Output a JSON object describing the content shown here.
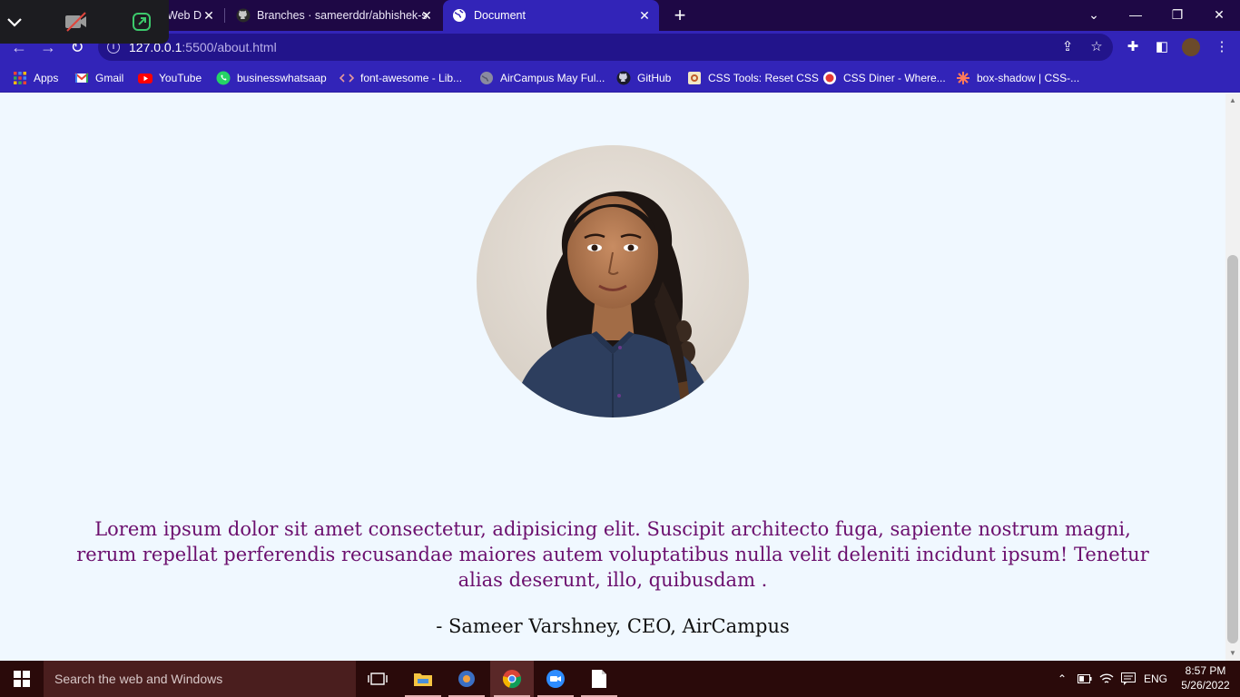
{
  "browser": {
    "tabs": [
      {
        "label": "Web D",
        "favicon": "webdev-icon"
      },
      {
        "label": "Branches · sameerddr/abhishek-s",
        "favicon": "github-icon"
      },
      {
        "label": "Document",
        "favicon": "globe-icon",
        "active": true
      }
    ],
    "url_host": "127.0.0.1",
    "url_path": ":5500/about.html",
    "accent": "#3224b8"
  },
  "bookmarks": [
    {
      "label": "Apps",
      "icon": "apps-grid-icon"
    },
    {
      "label": "Gmail",
      "icon": "gmail-icon"
    },
    {
      "label": "YouTube",
      "icon": "youtube-icon"
    },
    {
      "label": "businesswhatsaap",
      "icon": "whatsapp-icon"
    },
    {
      "label": "font-awesome - Lib...",
      "icon": "code-icon"
    },
    {
      "label": "AirCampus May Ful...",
      "icon": "globe-icon"
    },
    {
      "label": "GitHub",
      "icon": "github-icon"
    },
    {
      "label": "CSS Tools: Reset CSS",
      "icon": "css-tools-icon"
    },
    {
      "label": "CSS Diner - Where...",
      "icon": "css-diner-icon"
    },
    {
      "label": "box-shadow | CSS-...",
      "icon": "css-tricks-icon"
    }
  ],
  "page": {
    "quote": "Lorem ipsum dolor sit amet consectetur, adipisicing elit. Suscipit architecto fuga, sapiente nostrum magni, rerum repellat perferendis recusandae maiores autem voluptatibus nulla velit deleniti incidunt ipsum! Tenetur alias deserunt, illo, quibusdam .",
    "author": "- Sameer Varshney, CEO, AirCampus",
    "quote_color": "#6b0f6e",
    "background": "#f0f8ff"
  },
  "taskbar": {
    "search_placeholder": "Search the web and Windows",
    "language": "ENG",
    "time": "8:57 PM",
    "date": "5/26/2022"
  }
}
